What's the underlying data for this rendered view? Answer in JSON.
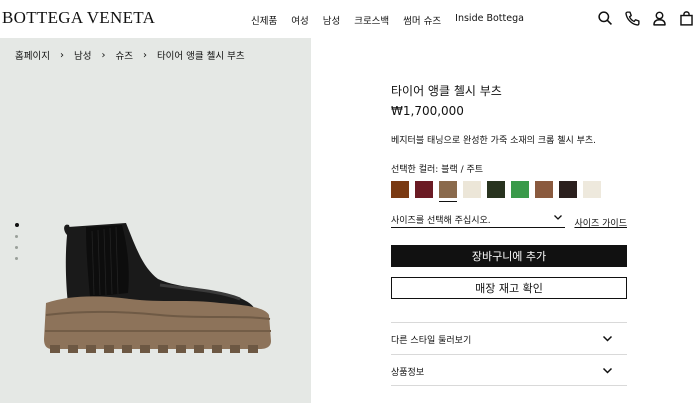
{
  "header": {
    "logo": "BOTTEGA VENETA",
    "nav": [
      "신제품",
      "여성",
      "남성",
      "크로스백",
      "썸머 슈즈",
      "Inside Bottega"
    ],
    "icons": [
      "search-icon",
      "phone-icon",
      "account-icon",
      "shopping-bag-icon"
    ]
  },
  "breadcrumb": [
    "홈페이지",
    "남성",
    "슈즈",
    "타이어 앵클 첼시 부츠"
  ],
  "gallery": {
    "dot_count": 4,
    "active_dot": 1
  },
  "product": {
    "title": "타이어 앵클 첼시 부츠",
    "price": "₩1,700,000",
    "description": "베지터블 태닝으로 완성한 가죽 소재의 크롬 첼시 부츠.",
    "color_label": "선택한 컬러: 블랙 / 주트",
    "swatches": [
      {
        "color": "#7a3a12"
      },
      {
        "color": "#6b1b24"
      },
      {
        "color": "#8a6a4c",
        "selected": true
      },
      {
        "color": "#ece6d8"
      },
      {
        "color": "#28331f"
      },
      {
        "color": "#3a9a4a"
      },
      {
        "color": "#8a5a3e"
      },
      {
        "color": "#2b201e"
      },
      {
        "color": "#eee9dd"
      }
    ],
    "size_placeholder": "사이즈를 선택해 주십시오.",
    "size_guide": "사이즈 가이드",
    "add_to_cart": "장바구니에 추가",
    "store_stock": "매장 재고 확인",
    "accordions": [
      "다른 스타일 둘러보기",
      "상품정보"
    ]
  }
}
